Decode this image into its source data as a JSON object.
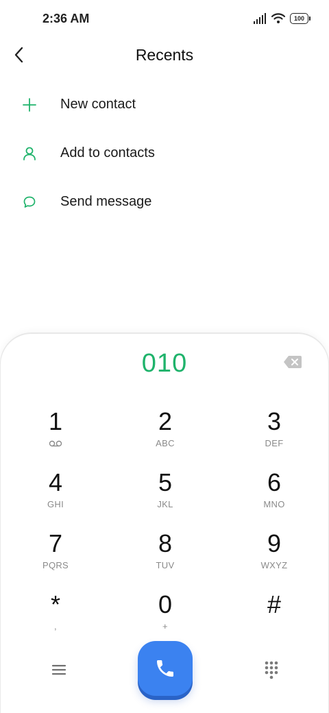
{
  "status_bar": {
    "time": "2:36 AM",
    "battery": "100"
  },
  "header": {
    "title": "Recents"
  },
  "menu": {
    "items": [
      {
        "label": "New contact",
        "icon": "plus-icon"
      },
      {
        "label": "Add to contacts",
        "icon": "person-icon"
      },
      {
        "label": "Send message",
        "icon": "chat-bubble-icon"
      }
    ]
  },
  "dialer": {
    "number": "010",
    "keys": [
      {
        "digit": "1",
        "letters": ""
      },
      {
        "digit": "2",
        "letters": "ABC"
      },
      {
        "digit": "3",
        "letters": "DEF"
      },
      {
        "digit": "4",
        "letters": "GHI"
      },
      {
        "digit": "5",
        "letters": "JKL"
      },
      {
        "digit": "6",
        "letters": "MNO"
      },
      {
        "digit": "7",
        "letters": "PQRS"
      },
      {
        "digit": "8",
        "letters": "TUV"
      },
      {
        "digit": "9",
        "letters": "WXYZ"
      },
      {
        "digit": "*",
        "letters": ","
      },
      {
        "digit": "0",
        "letters": "+"
      },
      {
        "digit": "#",
        "letters": ""
      }
    ]
  },
  "colors": {
    "accent_green": "#1fb36b",
    "call_blue": "#3b82f0"
  }
}
